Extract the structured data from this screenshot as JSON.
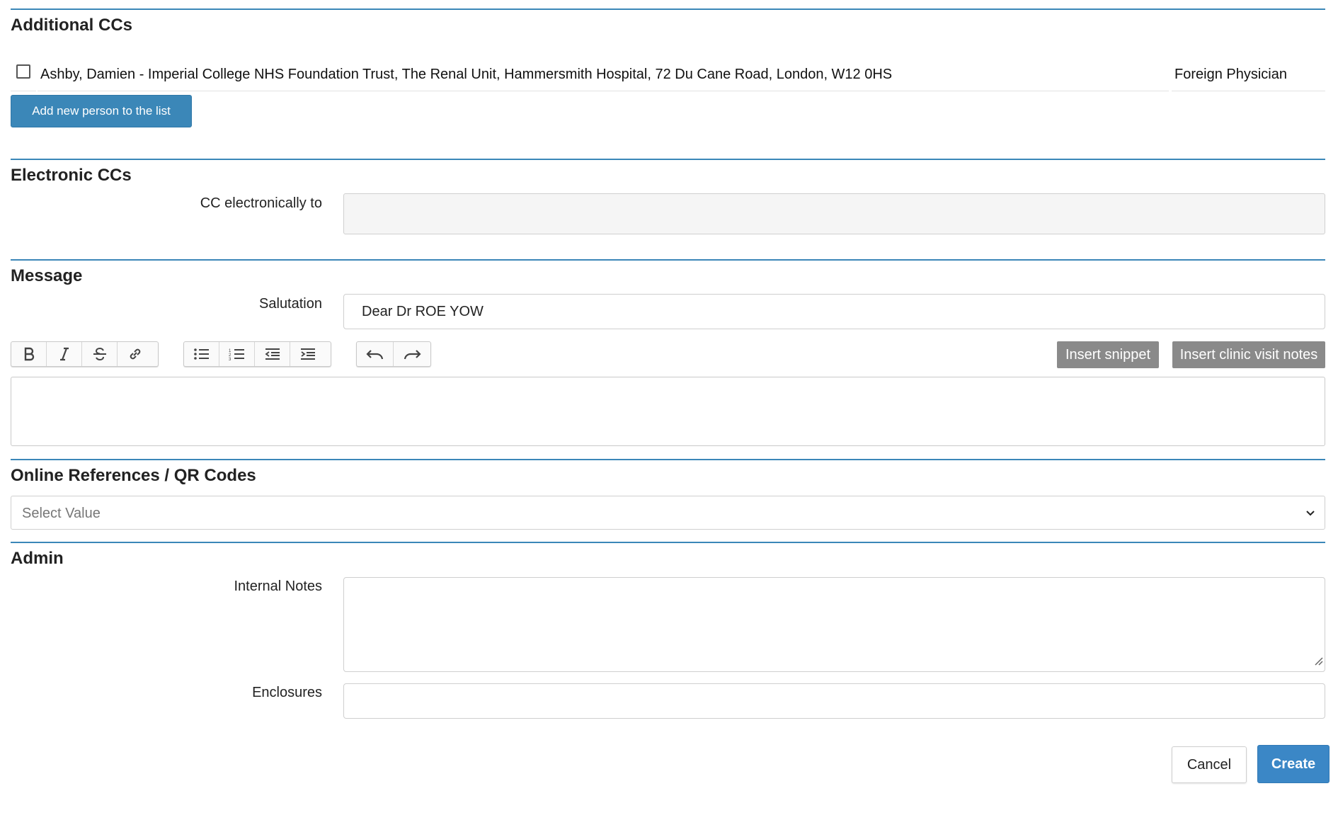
{
  "additional_ccs": {
    "heading": "Additional CCs",
    "rows": [
      {
        "checked": false,
        "name": "Ashby, Damien - Imperial College NHS Foundation Trust, The Renal Unit, Hammersmith Hospital, 72 Du Cane Road, London, W12 0HS",
        "role": "Foreign Physician"
      }
    ],
    "add_button_label": "Add new person to the list"
  },
  "electronic_ccs": {
    "heading": "Electronic CCs",
    "cc_label": "CC electronically to",
    "cc_value": ""
  },
  "message": {
    "heading": "Message",
    "salutation_label": "Salutation",
    "salutation_value": "Dear Dr ROE YOW",
    "toolbar": {
      "format": [
        "bold-icon",
        "italic-icon",
        "strikethrough-icon",
        "link-icon"
      ],
      "lists": [
        "bullet-list-icon",
        "numbered-list-icon",
        "outdent-icon",
        "indent-icon"
      ],
      "history": [
        "undo-icon",
        "redo-icon"
      ]
    },
    "insert_snippet_label": "Insert snippet",
    "insert_clinic_notes_label": "Insert clinic visit notes",
    "body": ""
  },
  "online_references": {
    "heading": "Online References / QR Codes",
    "select_placeholder": "Select Value"
  },
  "admin": {
    "heading": "Admin",
    "internal_notes_label": "Internal Notes",
    "internal_notes_value": "",
    "enclosures_label": "Enclosures",
    "enclosures_value": ""
  },
  "actions": {
    "cancel_label": "Cancel",
    "create_label": "Create"
  },
  "colors": {
    "accent": "#3b87b8",
    "primary_button": "#3b87c6",
    "gray_button": "#8a8a8a"
  }
}
